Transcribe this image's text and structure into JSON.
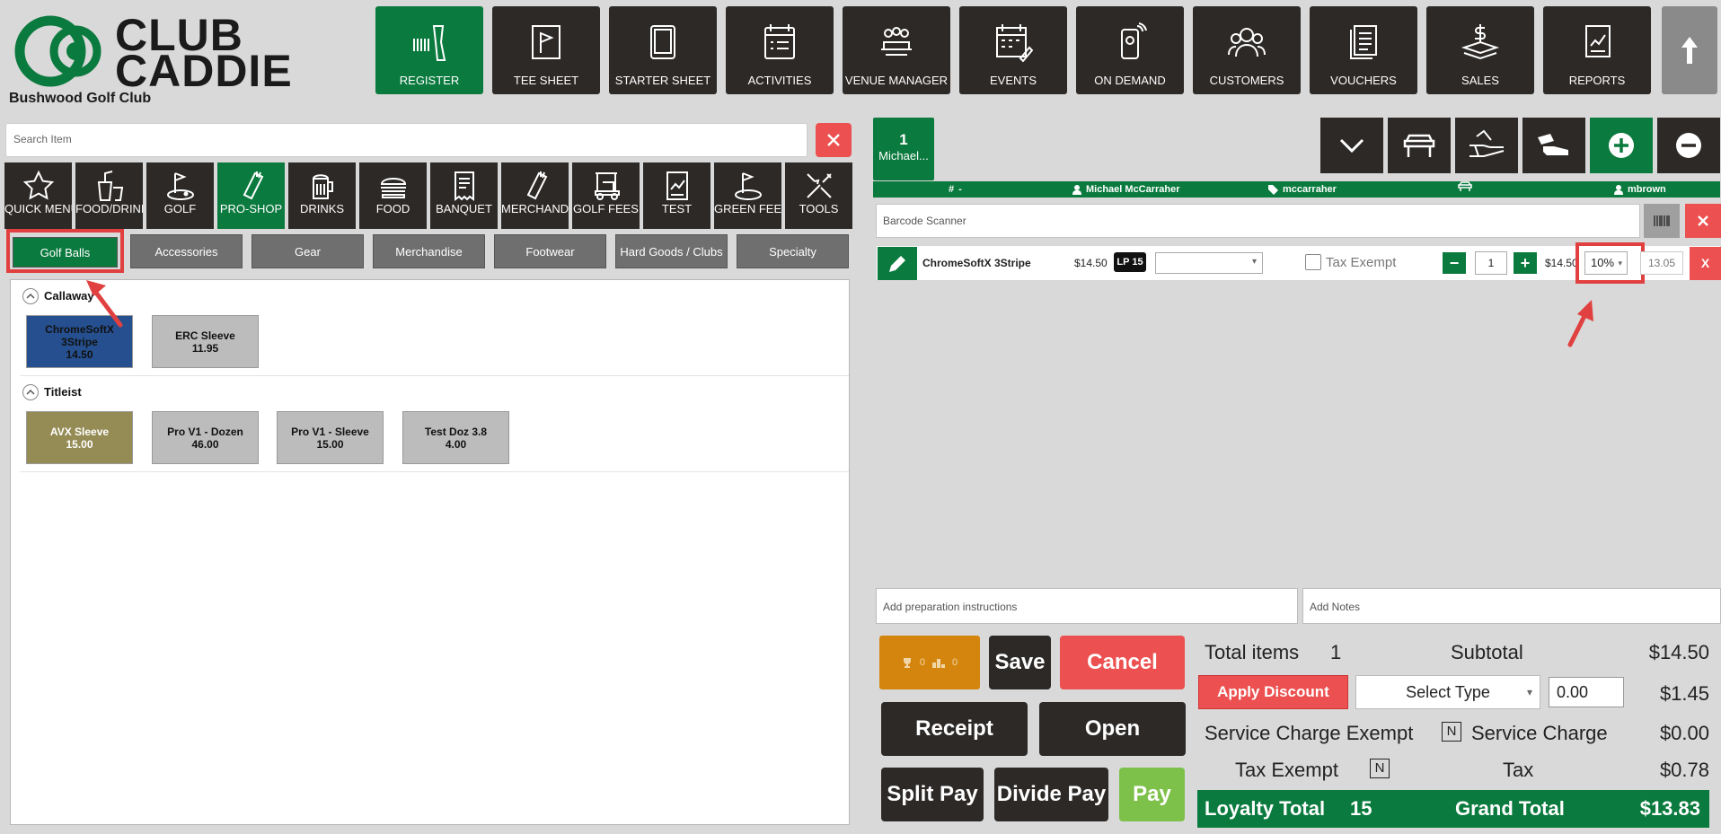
{
  "brand": {
    "line1": "CLUB",
    "line2": "CADDIE",
    "club_name": "Bushwood Golf Club",
    "colors": {
      "primary_green": "#0b7a3e",
      "dark": "#2c2927",
      "danger": "#ec5050",
      "loyalty": "#d4850e",
      "pay": "#7dc14b"
    }
  },
  "nav": {
    "items": [
      {
        "label": "REGISTER",
        "icon": "barcode-scanner-icon"
      },
      {
        "label": "TEE SHEET",
        "icon": "flag-icon"
      },
      {
        "label": "STARTER SHEET",
        "icon": "tablet-icon"
      },
      {
        "label": "ACTIVITIES",
        "icon": "checklist-icon"
      },
      {
        "label": "VENUE MANAGER",
        "icon": "meeting-icon"
      },
      {
        "label": "EVENTS",
        "icon": "calendar-icon"
      },
      {
        "label": "ON DEMAND",
        "icon": "phone-icon"
      },
      {
        "label": "CUSTOMERS",
        "icon": "users-icon"
      },
      {
        "label": "VOUCHERS",
        "icon": "document-icon"
      },
      {
        "label": "SALES",
        "icon": "money-icon"
      },
      {
        "label": "REPORTS",
        "icon": "report-icon"
      }
    ],
    "active": "REGISTER",
    "up_icon": "arrow-up-icon"
  },
  "search": {
    "placeholder": "Search Item"
  },
  "categories": [
    {
      "label": "QUICK MENU",
      "icon": "star-icon"
    },
    {
      "label": "FOOD/DRINK",
      "icon": "food-drink-icon"
    },
    {
      "label": "GOLF",
      "icon": "golfer-icon"
    },
    {
      "label": "PRO-SHOP",
      "icon": "golf-bag-icon"
    },
    {
      "label": "DRINKS",
      "icon": "beer-icon"
    },
    {
      "label": "FOOD",
      "icon": "burger-icon"
    },
    {
      "label": "BANQUET",
      "icon": "receipt-icon"
    },
    {
      "label": "MERCHANDISE",
      "icon": "golf-bag-icon"
    },
    {
      "label": "GOLF FEES",
      "icon": "golf-cart-icon"
    },
    {
      "label": "TEST",
      "icon": "chart-doc-icon"
    },
    {
      "label": "GREEN FEES",
      "icon": "golfer-icon"
    },
    {
      "label": "TOOLS",
      "icon": "tools-icon"
    }
  ],
  "active_category": "PRO-SHOP",
  "subcategories": [
    "Golf Balls",
    "Accessories",
    "Gear",
    "Merchandise",
    "Footwear",
    "Hard Goods / Clubs",
    "Specialty"
  ],
  "groups": [
    {
      "name": "Callaway",
      "items": [
        {
          "name": "ChromeSoftX 3Stripe",
          "price": "14.50"
        },
        {
          "name": "ERC Sleeve",
          "price": "11.95"
        }
      ]
    },
    {
      "name": "Titleist",
      "items": [
        {
          "name": "AVX Sleeve",
          "price": "15.00"
        },
        {
          "name": "Pro V1 - Dozen",
          "price": "46.00"
        },
        {
          "name": "Pro V1 - Sleeve",
          "price": "15.00"
        },
        {
          "name": "Test Doz 3.8",
          "price": "4.00"
        }
      ]
    }
  ],
  "tab": {
    "number": "1",
    "name": "Michael..."
  },
  "info_bar": {
    "table": "-",
    "customer": "Michael McCarraher",
    "tag": "mccarraher",
    "cart": "",
    "server": "mbrown"
  },
  "barcode": {
    "placeholder": "Barcode Scanner"
  },
  "line_item": {
    "name": "ChromeSoftX 3Stripe",
    "price": "$14.50",
    "lp_label": "LP",
    "lp_value": "15",
    "modifier": "",
    "tax_exempt_label": "Tax Exempt",
    "qty": "1",
    "unit_price": "$14.50",
    "discount": "10%",
    "total": "13.05",
    "remove": "X"
  },
  "prep": {
    "placeholder": "Add preparation instructions"
  },
  "notes": {
    "placeholder": "Add Notes"
  },
  "loyalty_button": {
    "a": "0",
    "b": "0"
  },
  "actions": {
    "save": "Save",
    "cancel": "Cancel",
    "receipt": "Receipt",
    "open": "Open",
    "split_pay": "Split Pay",
    "divide_pay": "Divide Pay",
    "pay": "Pay"
  },
  "summary": {
    "total_items_label": "Total items",
    "total_items": "1",
    "subtotal_label": "Subtotal",
    "subtotal": "$14.50",
    "apply_discount": "Apply Discount",
    "select_type": "Select Type",
    "discount_input": "0.00",
    "discount_amount": "$1.45",
    "service_exempt_label": "Service Charge Exempt",
    "service_exempt": "N",
    "service_charge_label": "Service Charge",
    "service_charge": "$0.00",
    "tax_exempt_label": "Tax Exempt",
    "tax_exempt": "N",
    "tax_label": "Tax",
    "tax": "$0.78",
    "loyalty_label": "Loyalty Total",
    "loyalty": "15",
    "grand_label": "Grand Total",
    "grand": "$13.83"
  }
}
